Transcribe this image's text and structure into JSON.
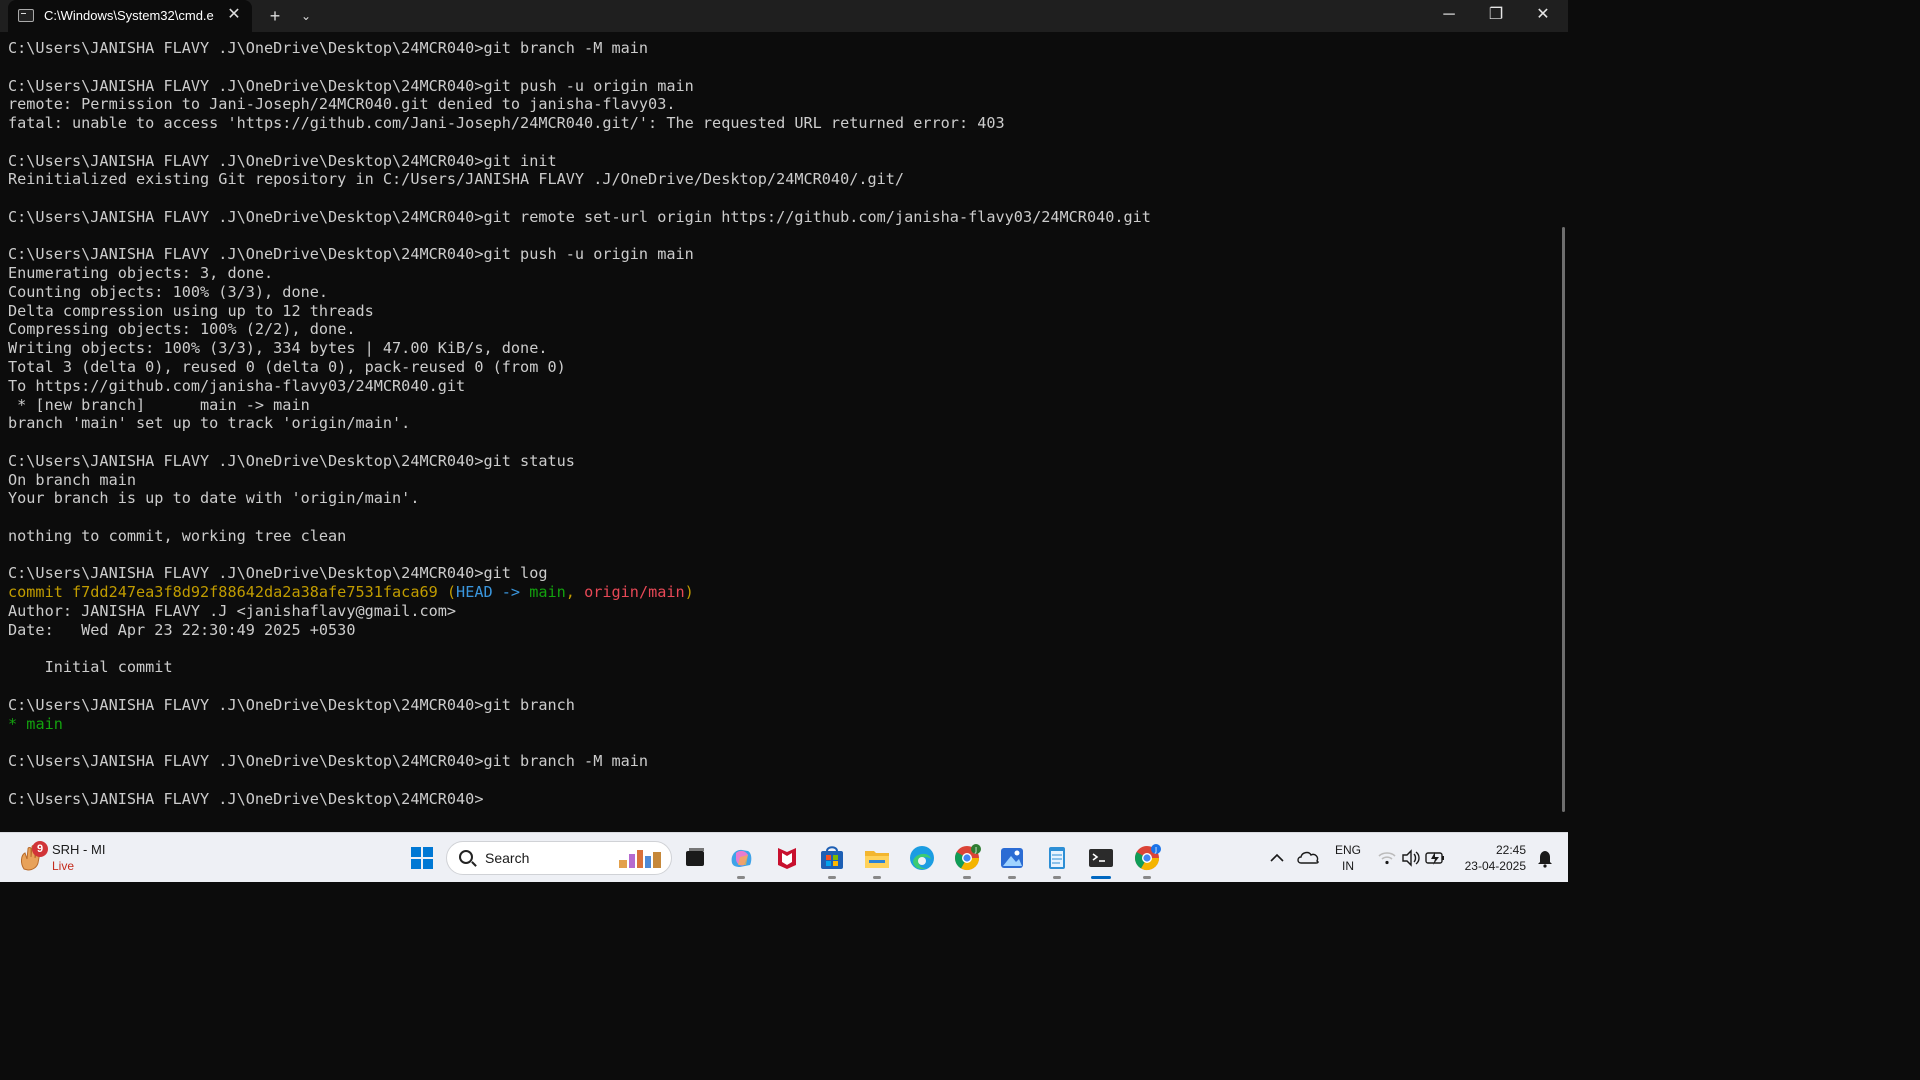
{
  "window": {
    "tab_title": "C:\\Windows\\System32\\cmd.e",
    "close_tab_glyph": "✕",
    "new_tab_glyph": "+",
    "dropdown_glyph": "⌄",
    "minimize_glyph": "─",
    "maximize_glyph": "❐",
    "close_glyph": "✕"
  },
  "terminal": {
    "lines": [
      [
        {
          "t": "C:\\Users\\JANISHA FLAVY .J\\OneDrive\\Desktop\\24MCR040>git branch -M main"
        }
      ],
      [
        {
          "t": ""
        }
      ],
      [
        {
          "t": "C:\\Users\\JANISHA FLAVY .J\\OneDrive\\Desktop\\24MCR040>git push -u origin main"
        }
      ],
      [
        {
          "t": "remote: Permission to Jani-Joseph/24MCR040.git denied to janisha-flavy03."
        }
      ],
      [
        {
          "t": "fatal: unable to access 'https://github.com/Jani-Joseph/24MCR040.git/': The requested URL returned error: 403"
        }
      ],
      [
        {
          "t": ""
        }
      ],
      [
        {
          "t": "C:\\Users\\JANISHA FLAVY .J\\OneDrive\\Desktop\\24MCR040>git init"
        }
      ],
      [
        {
          "t": "Reinitialized existing Git repository in C:/Users/JANISHA FLAVY .J/OneDrive/Desktop/24MCR040/.git/"
        }
      ],
      [
        {
          "t": ""
        }
      ],
      [
        {
          "t": "C:\\Users\\JANISHA FLAVY .J\\OneDrive\\Desktop\\24MCR040>git remote set-url origin https://github.com/janisha-flavy03/24MCR040.git"
        }
      ],
      [
        {
          "t": ""
        }
      ],
      [
        {
          "t": "C:\\Users\\JANISHA FLAVY .J\\OneDrive\\Desktop\\24MCR040>git push -u origin main"
        }
      ],
      [
        {
          "t": "Enumerating objects: 3, done."
        }
      ],
      [
        {
          "t": "Counting objects: 100% (3/3), done."
        }
      ],
      [
        {
          "t": "Delta compression using up to 12 threads"
        }
      ],
      [
        {
          "t": "Compressing objects: 100% (2/2), done."
        }
      ],
      [
        {
          "t": "Writing objects: 100% (3/3), 334 bytes | 47.00 KiB/s, done."
        }
      ],
      [
        {
          "t": "Total 3 (delta 0), reused 0 (delta 0), pack-reused 0 (from 0)"
        }
      ],
      [
        {
          "t": "To https://github.com/janisha-flavy03/24MCR040.git"
        }
      ],
      [
        {
          "t": " * [new branch]      main -> main"
        }
      ],
      [
        {
          "t": "branch 'main' set up to track 'origin/main'."
        }
      ],
      [
        {
          "t": ""
        }
      ],
      [
        {
          "t": "C:\\Users\\JANISHA FLAVY .J\\OneDrive\\Desktop\\24MCR040>git status"
        }
      ],
      [
        {
          "t": "On branch main"
        }
      ],
      [
        {
          "t": "Your branch is up to date with 'origin/main'."
        }
      ],
      [
        {
          "t": ""
        }
      ],
      [
        {
          "t": "nothing to commit, working tree clean"
        }
      ],
      [
        {
          "t": ""
        }
      ],
      [
        {
          "t": "C:\\Users\\JANISHA FLAVY .J\\OneDrive\\Desktop\\24MCR040>git log"
        }
      ],
      [
        {
          "t": "commit f7dd247ea3f8d92f88642da2a38afe7531faca69 (",
          "c": "yellow"
        },
        {
          "t": "HEAD -> ",
          "c": "cyan"
        },
        {
          "t": "main",
          "c": "green"
        },
        {
          "t": ", ",
          "c": "yellow"
        },
        {
          "t": "origin/main",
          "c": "red"
        },
        {
          "t": ")",
          "c": "yellow"
        }
      ],
      [
        {
          "t": "Author: JANISHA FLAVY .J <janishaflavy@gmail.com>"
        }
      ],
      [
        {
          "t": "Date:   Wed Apr 23 22:30:49 2025 +0530"
        }
      ],
      [
        {
          "t": ""
        }
      ],
      [
        {
          "t": "    Initial commit"
        }
      ],
      [
        {
          "t": ""
        }
      ],
      [
        {
          "t": "C:\\Users\\JANISHA FLAVY .J\\OneDrive\\Desktop\\24MCR040>git branch"
        }
      ],
      [
        {
          "t": "* ",
          "c": "green"
        },
        {
          "t": "main",
          "c": "green"
        }
      ],
      [
        {
          "t": ""
        }
      ],
      [
        {
          "t": "C:\\Users\\JANISHA FLAVY .J\\OneDrive\\Desktop\\24MCR040>git branch -M main"
        }
      ],
      [
        {
          "t": ""
        }
      ],
      [
        {
          "t": "C:\\Users\\JANISHA FLAVY .J\\OneDrive\\Desktop\\24MCR040>"
        }
      ]
    ],
    "colors": {
      "yellow": "#c19c00",
      "cyan": "#3a96dd",
      "green": "#13a10e",
      "red": "#e74856",
      "default": "#cccccc",
      "background": "#0c0c0c"
    }
  },
  "taskbar": {
    "weather": {
      "badge": "9",
      "title": "SRH - MI",
      "subtitle": "Live"
    },
    "search_label": "Search",
    "icons": [
      "start-icon",
      "task-view-icon",
      "copilot-icon",
      "mcafee-icon",
      "microsoft-store-icon",
      "file-explorer-icon",
      "edge-icon",
      "chrome-profile-j-icon",
      "photos-icon",
      "notepad-icon",
      "terminal-icon",
      "chrome-profile-j2-icon"
    ],
    "tray": {
      "lang_line1": "ENG",
      "lang_line2": "IN",
      "time": "22:45",
      "date": "23-04-2025"
    }
  }
}
